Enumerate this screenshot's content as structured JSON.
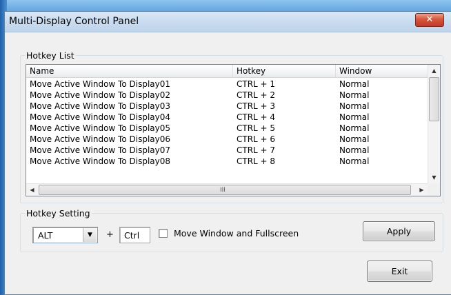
{
  "window": {
    "title": "Multi-Display Control Panel",
    "close_symbol": "✕"
  },
  "hotkey_list": {
    "legend": "Hotkey List",
    "columns": [
      "Name",
      "Hotkey",
      "Window"
    ],
    "rows": [
      [
        "Move Active Window To Display01",
        "CTRL + 1",
        "Normal"
      ],
      [
        "Move Active Window To Display02",
        "CTRL + 2",
        "Normal"
      ],
      [
        "Move Active Window To Display03",
        "CTRL + 3",
        "Normal"
      ],
      [
        "Move Active Window To Display04",
        "CTRL + 4",
        "Normal"
      ],
      [
        "Move Active Window To Display05",
        "CTRL + 5",
        "Normal"
      ],
      [
        "Move Active Window To Display06",
        "CTRL + 6",
        "Normal"
      ],
      [
        "Move Active Window To Display07",
        "CTRL + 7",
        "Normal"
      ],
      [
        "Move Active Window To Display08",
        "CTRL + 8",
        "Normal"
      ]
    ],
    "scroll_grip": "III"
  },
  "hotkey_setting": {
    "legend": "Hotkey Setting",
    "modifier_selected": "ALT",
    "plus": "+",
    "key_value": "Ctrl",
    "fullscreen_label": "Move Window and Fullscreen",
    "fullscreen_checked": false,
    "apply_label": "Apply"
  },
  "exit_label": "Exit"
}
